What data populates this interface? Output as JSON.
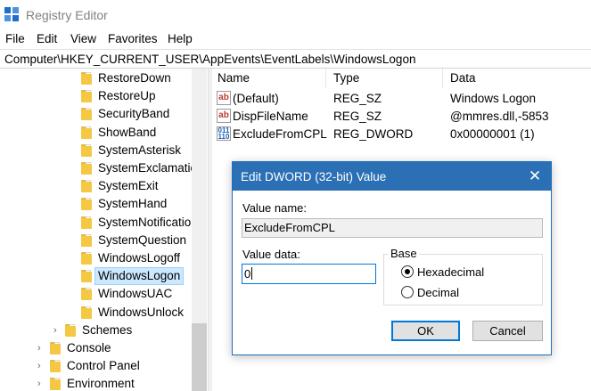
{
  "window": {
    "title": "Registry Editor"
  },
  "menu": [
    "File",
    "Edit",
    "View",
    "Favorites",
    "Help"
  ],
  "address": "Computer\\HKEY_CURRENT_USER\\AppEvents\\EventLabels\\WindowsLogon",
  "tree": {
    "items": [
      {
        "label": "RestoreDown"
      },
      {
        "label": "RestoreUp"
      },
      {
        "label": "SecurityBand"
      },
      {
        "label": "ShowBand"
      },
      {
        "label": "SystemAsterisk"
      },
      {
        "label": "SystemExclamation"
      },
      {
        "label": "SystemExit"
      },
      {
        "label": "SystemHand"
      },
      {
        "label": "SystemNotification"
      },
      {
        "label": "SystemQuestion"
      },
      {
        "label": "WindowsLogoff"
      },
      {
        "label": "WindowsLogon"
      },
      {
        "label": "WindowsUAC"
      },
      {
        "label": "WindowsUnlock"
      },
      {
        "label": "Schemes"
      },
      {
        "label": "Console"
      },
      {
        "label": "Control Panel"
      },
      {
        "label": "Environment"
      }
    ],
    "selected": "WindowsLogon"
  },
  "list": {
    "columns": {
      "name": "Name",
      "type": "Type",
      "data": "Data"
    },
    "rows": [
      {
        "name": "(Default)",
        "type": "REG_SZ",
        "data": "Windows Logon",
        "icon": "ab"
      },
      {
        "name": "DispFileName",
        "type": "REG_SZ",
        "data": "@mmres.dll,-5853",
        "icon": "ab"
      },
      {
        "name": "ExcludeFromCPL",
        "type": "REG_DWORD",
        "data": "0x00000001 (1)",
        "icon": "011\n110"
      }
    ]
  },
  "dialog": {
    "title": "Edit DWORD (32-bit) Value",
    "close_glyph": "✕",
    "value_name_label": "Value name:",
    "value_name": "ExcludeFromCPL",
    "value_data_label": "Value data:",
    "value_data": "0",
    "base_label": "Base",
    "base_options": [
      "Hexadecimal",
      "Decimal"
    ],
    "base_selected": "Hexadecimal",
    "ok_label": "OK",
    "cancel_label": "Cancel"
  },
  "colors": {
    "accent": "#2b6fb5",
    "selection": "#cce8ff",
    "folder": "#f4c842"
  }
}
